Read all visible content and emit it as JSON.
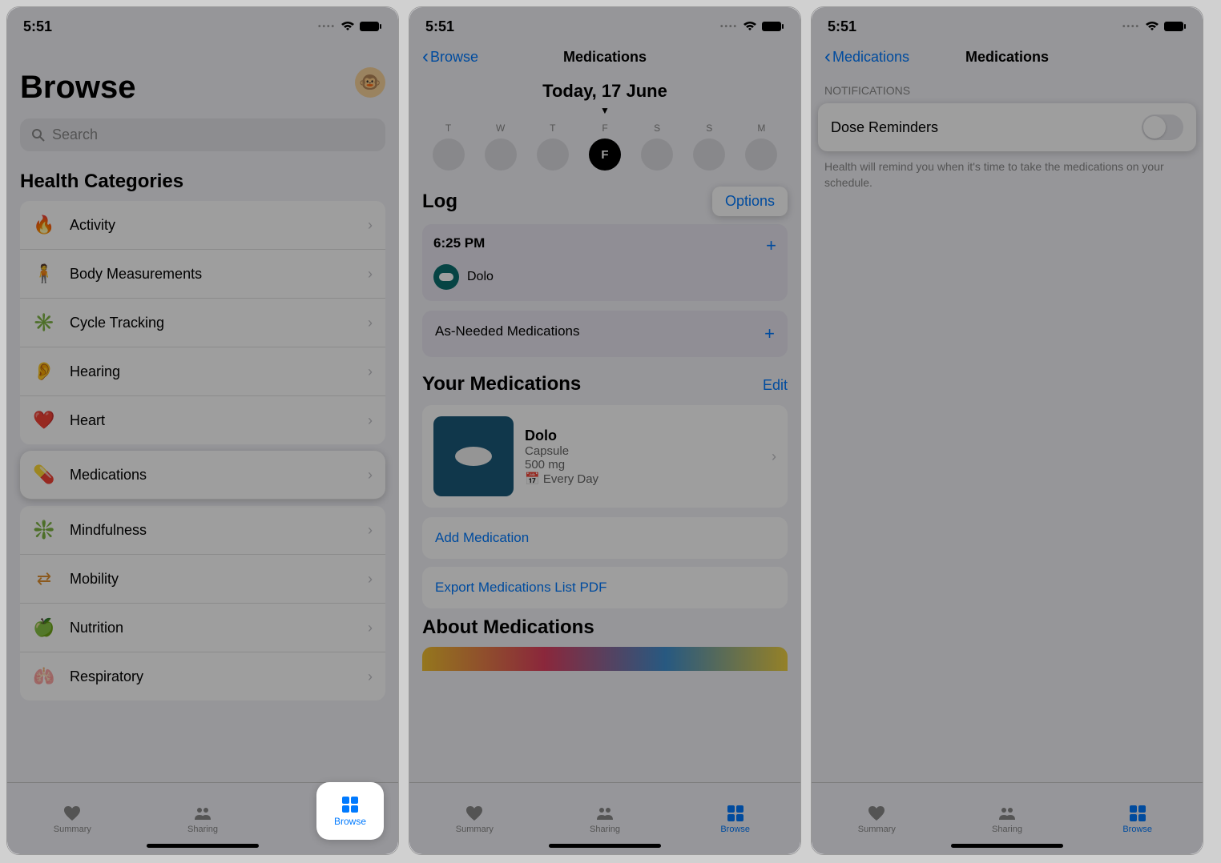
{
  "status": {
    "time": "5:51"
  },
  "screen1": {
    "title": "Browse",
    "search_placeholder": "Search",
    "section": "Health Categories",
    "categories": {
      "activity": "Activity",
      "body": "Body Measurements",
      "cycle": "Cycle Tracking",
      "hearing": "Hearing",
      "heart": "Heart",
      "medications": "Medications",
      "mindfulness": "Mindfulness",
      "mobility": "Mobility",
      "nutrition": "Nutrition",
      "respiratory": "Respiratory"
    }
  },
  "screen2": {
    "back": "Browse",
    "title": "Medications",
    "date": "Today, 17 June",
    "days": {
      "d0": "T",
      "d1": "W",
      "d2": "T",
      "d3": "F",
      "d4": "S",
      "d5": "S",
      "d6": "M"
    },
    "log": "Log",
    "options": "Options",
    "time": "6:25 PM",
    "med1": "Dolo",
    "as_needed": "As-Needed Medications",
    "your_meds": "Your Medications",
    "edit": "Edit",
    "med_name": "Dolo",
    "med_form": "Capsule",
    "med_dose": "500 mg",
    "med_freq": "Every Day",
    "add": "Add Medication",
    "export": "Export Medications List PDF",
    "about": "About Medications"
  },
  "screen3": {
    "back": "Medications",
    "title": "Medications",
    "section": "NOTIFICATIONS",
    "toggle_label": "Dose Reminders",
    "help": "Health will remind you when it's time to take the medications on your schedule."
  },
  "tabs": {
    "summary": "Summary",
    "sharing": "Sharing",
    "browse": "Browse"
  }
}
